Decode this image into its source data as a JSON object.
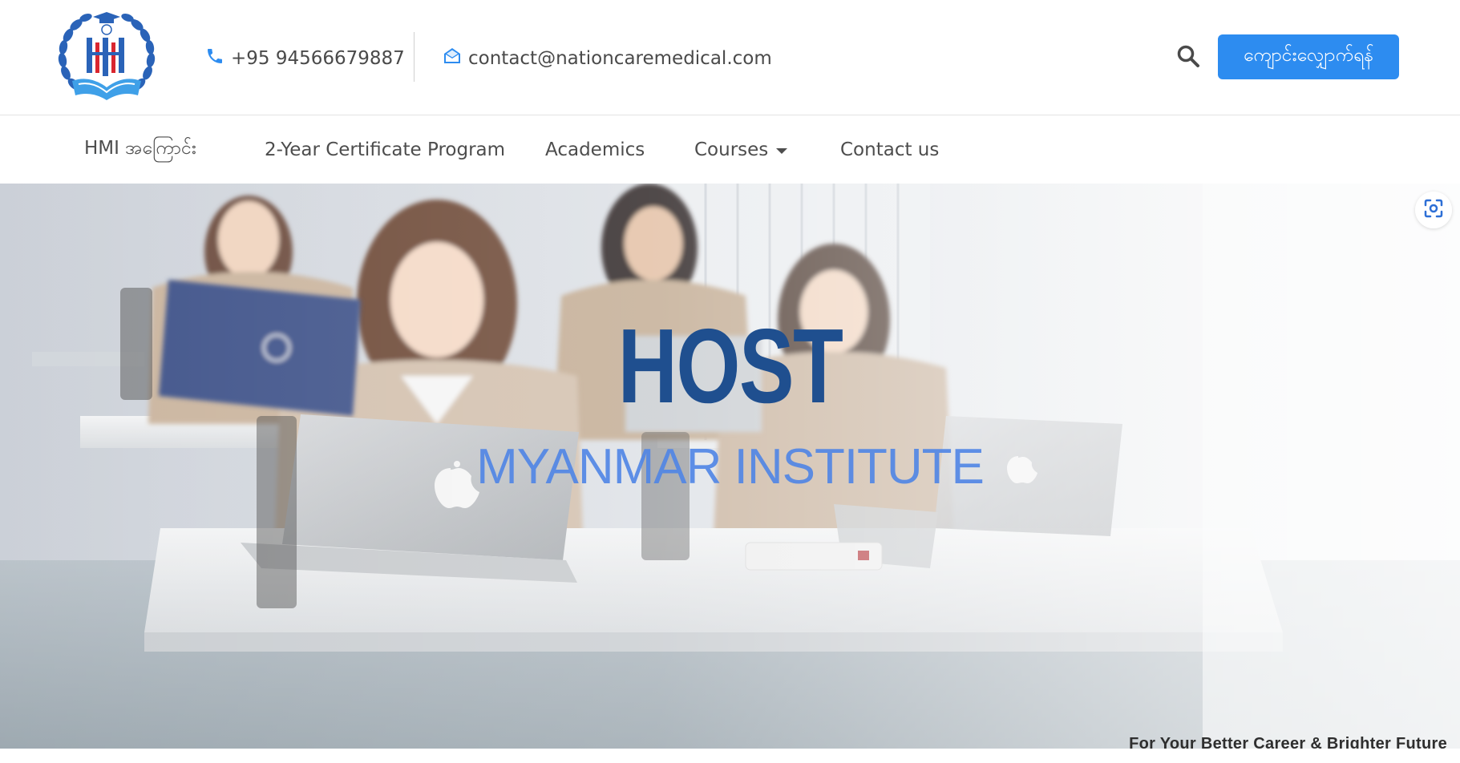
{
  "header": {
    "phone": "+95 94566679887",
    "email": "contact@nationcaremedical.com",
    "cta_label": "ကျောင်းလျှောက်ရန်"
  },
  "nav": {
    "items": [
      {
        "label": "HMI အကြောင်း"
      },
      {
        "label": "2-Year Certificate Program"
      },
      {
        "label": "Academics"
      },
      {
        "label": "Courses",
        "has_dropdown": true
      },
      {
        "label": "Contact us"
      }
    ]
  },
  "hero": {
    "title": "HOST",
    "subtitle": "MYANMAR INSTITUTE",
    "tagline": "For Your Better Career & Brighter Future"
  },
  "icons": {
    "phone": "phone-icon",
    "email": "envelope-open-icon",
    "search": "search-icon",
    "lens": "visual-search-icon",
    "logo": "graduation-laurel-logo"
  },
  "colors": {
    "accent": "#2d8cf0",
    "title_blue": "#1f4f8f",
    "subtitle_blue": "#4f85e6",
    "text_gray": "#4a4a4a"
  }
}
